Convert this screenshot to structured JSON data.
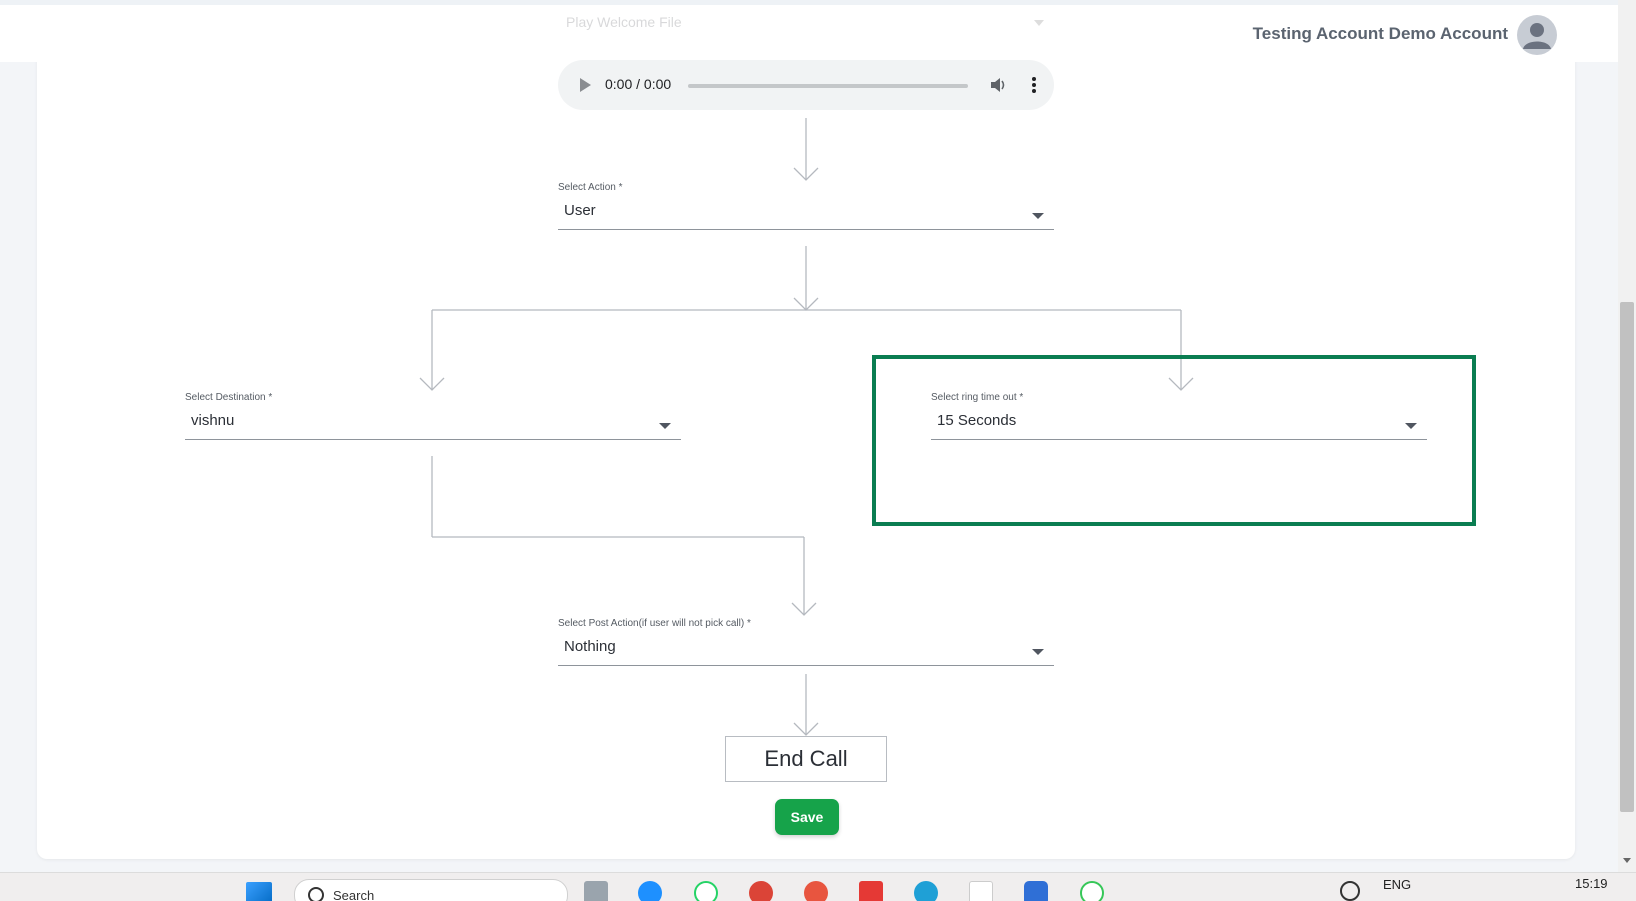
{
  "header": {
    "account_name": "Testing Account Demo Account",
    "avatar_icon": "user-avatar-icon"
  },
  "flow": {
    "top_select_value": "Play Welcome File",
    "audio_player": {
      "time": "0:00 / 0:00",
      "progress": 0
    },
    "select_action": {
      "label": "Select Action *",
      "value": "User"
    },
    "select_destination": {
      "label": "Select Destination *",
      "value": "vishnu"
    },
    "select_ring_timeout": {
      "label": "Select ring time out *",
      "value": "15 Seconds"
    },
    "select_post_action": {
      "label": "Select Post Action(if user will not pick call) *",
      "value": "Nothing"
    },
    "end_call_label": "End Call",
    "save_label": "Save"
  },
  "taskbar": {
    "search_text": "Search",
    "language": "ENG",
    "time": "15:19"
  },
  "colors": {
    "highlight": "#0a7d51",
    "save_button": "#16a34a",
    "connector": "#b5b9bf"
  }
}
